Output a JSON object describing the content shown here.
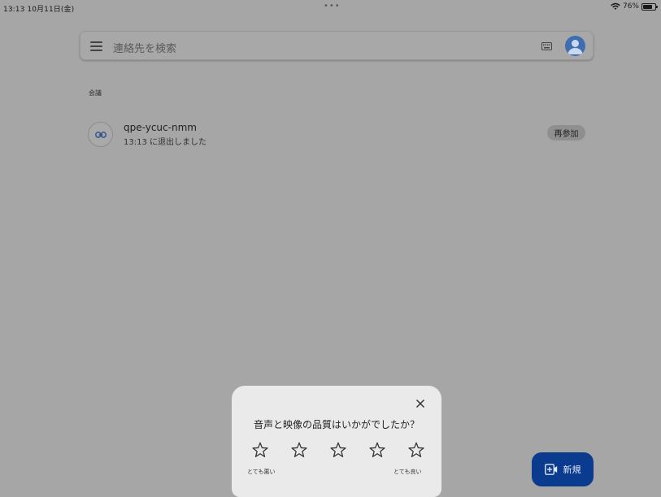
{
  "status_bar": {
    "time_date": "13:13  10月11日(金)",
    "dots": "•••",
    "battery": "76%",
    "battery_level": 0.76
  },
  "search": {
    "placeholder": "連絡先を検索"
  },
  "section": {
    "label": "会議"
  },
  "meeting": {
    "code": "qpe-ycuc-nmm",
    "status": "13:13 に退出しました",
    "rejoin_label": "再参加"
  },
  "rating_dialog": {
    "question": "音声と映像の品質はいかがでしたか？",
    "low_label": "とても悪い",
    "high_label": "とても良い",
    "star_count": 5
  },
  "fab": {
    "label": "新規"
  },
  "colors": {
    "overlay_background": "#a6a6a6",
    "dialog_background": "#eaeaea",
    "fab_background": "#0b3b8f",
    "avatar": "#3e6db0"
  }
}
